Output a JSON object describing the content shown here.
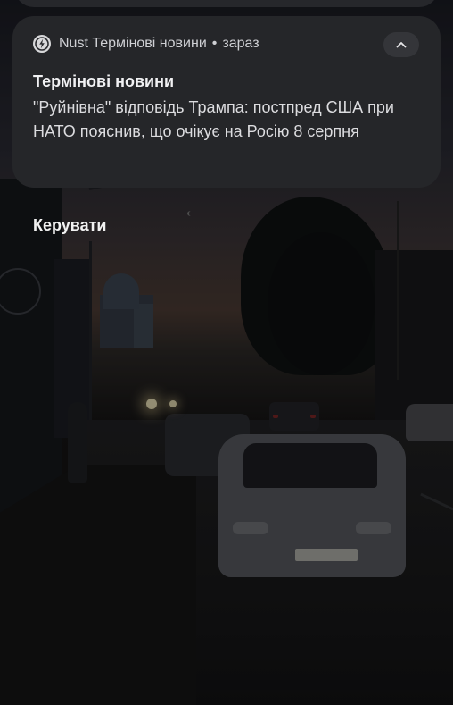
{
  "notification": {
    "app_name": "Nust Термінові новини",
    "separator": "•",
    "time": "зараз",
    "app_icon": "news-logo-icon",
    "expand_icon": "chevron-up-icon",
    "title": "Термінові новини",
    "body": "\"Руйнівна\" відповідь Трампа: постпред США при НАТО пояснив, що очікує на Росію 8 серпня"
  },
  "manage_label": "Керувати",
  "colors": {
    "card_background": "#252629",
    "text_primary": "#f1f1f3",
    "text_secondary": "#cfd0d4"
  }
}
